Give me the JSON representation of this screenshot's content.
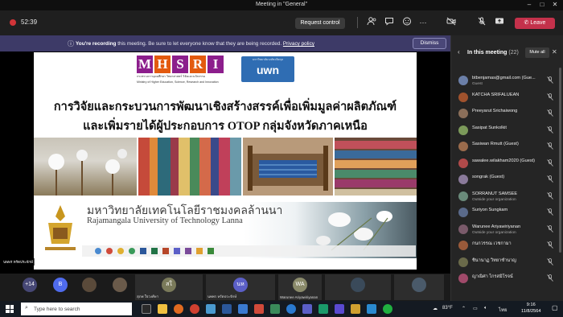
{
  "window": {
    "title": "Meeting in \"General\"",
    "controls": [
      "–",
      "□",
      "✕"
    ]
  },
  "toolbar": {
    "timer": "52:39",
    "request_control": "Request control",
    "leave": "Leave",
    "leave_color": "#c4314b",
    "icons": [
      "participants-icon",
      "chat-icon",
      "reactions-icon",
      "more-icon",
      "camera-off-icon",
      "mic-off-icon",
      "share-icon"
    ]
  },
  "banner": {
    "bold": "You're recording",
    "text": "this meeting. Be sure to let everyone know that they are being recorded.",
    "link": "Privacy policy",
    "dismiss": "Dismiss",
    "bg_color": "#3d3a67"
  },
  "slide": {
    "logo_letters": [
      "M",
      "H",
      "S",
      "R",
      "I"
    ],
    "logo_sub_th": "กระทรวงการอุดมศึกษา วิทยาศาสตร์ วิจัยและนวัตกรรม",
    "logo_sub_en": "Ministry of Higher Education, Science, Research and Innovation",
    "uwn_top": "มหาวิทยาลัยวงษ์ชวลิตกุล",
    "uwn_text": "uwn",
    "title_line1": "การวิจัยและกระบวนการพัฒนาเชิงสร้างสรรค์เพื่อเพิ่มมูลค่าผลิตภัณฑ์",
    "title_line2": "และเพิ่มรายได้ผู้ประกอบการ OTOP กลุ่มจังหวัดภาคเหนือ",
    "university_th": "มหาวิทยาลัยเทคโนโลยีราชมงคลล้านนา",
    "university_en": "Rajamangala University of Technology Lanna",
    "presenter": "นพพร หรัดประจักษ์"
  },
  "panel": {
    "title": "In this meeting",
    "count": "(22)",
    "mute_all": "Mute all",
    "participants": [
      {
        "name": "btbenjamas@gmail.com (Gue...",
        "sub": "Guest",
        "color": "#6b7fa8",
        "initial": ""
      },
      {
        "name": "KATCHA SRIFALUEAN",
        "sub": "",
        "color": "#a0522d",
        "initial": ""
      },
      {
        "name": "Preeyarut Srichaiwong",
        "sub": "",
        "color": "#8b6f5a",
        "initial": ""
      },
      {
        "name": "Sasipat Sunkolkit",
        "sub": "",
        "color": "#7c9a5a",
        "initial": ""
      },
      {
        "name": "Sasiwan Rmutt (Guest)",
        "sub": "",
        "color": "#9a6b4c",
        "initial": ""
      },
      {
        "name": "sawalee.wilakham2020 (Guest)",
        "sub": "",
        "color": "#b04a4a",
        "initial": ""
      },
      {
        "name": "songrak (Guest)",
        "sub": "",
        "color": "#8a7a9a",
        "initial": ""
      },
      {
        "name": "SORRANUT SAMSEE",
        "sub": "Outside your organization",
        "color": "#6a8a7a",
        "initial": ""
      },
      {
        "name": "Suriyon Sungkam",
        "sub": "",
        "color": "#5a6a8a",
        "initial": ""
      },
      {
        "name": "Warunee Ariyawiriyanan",
        "sub": "Outside your organization",
        "color": "#7a5a6a",
        "initial": ""
      },
      {
        "name": "กนกวรรณ เวชกามา",
        "sub": "",
        "color": "#9a5a3a",
        "initial": ""
      },
      {
        "name": "ชินานาฏ วิทยาชำนาญ",
        "sub": "",
        "color": "#6a6a4a",
        "initial": ""
      },
      {
        "name": "ญาณิศา ไกรสมิโรจน์",
        "sub": "",
        "color": "#a04a6a",
        "initial": ""
      }
    ]
  },
  "strip": {
    "tiles": [
      {
        "label": "",
        "initial": "+14",
        "color": "#464775"
      },
      {
        "label": "",
        "initial": "B",
        "color": "#4f6bed"
      },
      {
        "label": "",
        "initial": "",
        "color": "#5a4a3a"
      },
      {
        "label": "",
        "initial": "",
        "color": "#6a5a4a"
      },
      {
        "label": "สุภพ ใจวงศ์ษา",
        "initial": "สใ",
        "color": "#7a7a5a"
      },
      {
        "label": "นพพร หรัดประจักษ์",
        "initial": "นห",
        "color": "#5b5fc7"
      },
      {
        "label": "Warunee Ariyawiriyanan",
        "initial": "WA",
        "color": "#8a8a6a"
      },
      {
        "label": "",
        "initial": "",
        "color": "#3a4a5a"
      },
      {
        "label": "",
        "initial": "",
        "color": "#4a5a6a"
      }
    ]
  },
  "taskbar": {
    "search_placeholder": "Type here to search",
    "weather": "83°F",
    "language": "ไทย",
    "time": "9:16",
    "date": "11/8/2564"
  }
}
